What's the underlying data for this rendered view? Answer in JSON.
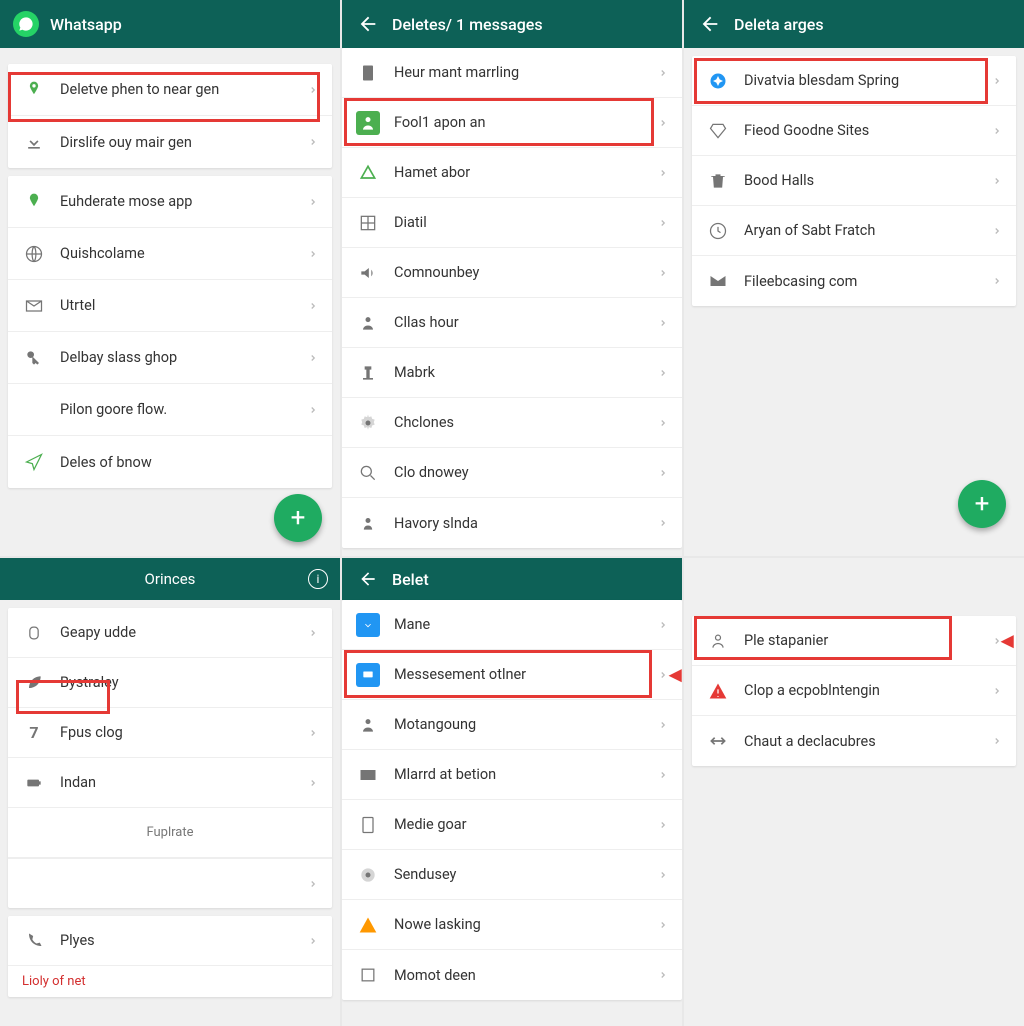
{
  "panel1": {
    "header_title": "Whatsapp",
    "top_items": [
      {
        "icon": "person-pin",
        "label": "Deletve phen to near gen",
        "green": true
      },
      {
        "icon": "download",
        "label": "Dirslife ouy mair gen",
        "green": false
      }
    ],
    "list_items": [
      {
        "icon": "person-pin",
        "label": "Euhderate mose app",
        "green": true
      },
      {
        "icon": "globe",
        "label": "Quishcolame",
        "green": false
      },
      {
        "icon": "mail",
        "label": "Utrtel",
        "green": false
      },
      {
        "icon": "key",
        "label": "Delbay slass ghop",
        "green": false
      },
      {
        "icon": "",
        "label": "Pilon goore flow.",
        "green": false
      },
      {
        "icon": "send",
        "label": "Deles of bnow",
        "green": true
      }
    ]
  },
  "panel2": {
    "header_title": "Deletes/ 1 messages",
    "items": [
      {
        "icon": "doc",
        "label": "Heur mant marrling"
      },
      {
        "icon": "person-green",
        "label": "Fool1 apon an",
        "green": true
      },
      {
        "icon": "triangle",
        "label": "Hamet abor",
        "green": true
      },
      {
        "icon": "grid",
        "label": "Diatil"
      },
      {
        "icon": "sound",
        "label": "Comnounbey"
      },
      {
        "icon": "person",
        "label": "Cllas hour"
      },
      {
        "icon": "monument",
        "label": "Mabrk"
      },
      {
        "icon": "gear",
        "label": "Chclones"
      },
      {
        "icon": "search-person",
        "label": "Clo dnowey"
      },
      {
        "icon": "contact",
        "label": "Havory slnda"
      }
    ]
  },
  "panel3": {
    "header_title": "Deleta arges",
    "items": [
      {
        "icon": "compass",
        "label": "Divatvia blesdam Spring",
        "blue": true
      },
      {
        "icon": "diamond",
        "label": "Fieod Goodne Sites"
      },
      {
        "icon": "trash",
        "label": "Bood Halls"
      },
      {
        "icon": "clock",
        "label": "Aryan of Sabt Fratch"
      },
      {
        "icon": "mail",
        "label": "Fileebcasing com"
      }
    ]
  },
  "panel4": {
    "header_title": "Orinces",
    "items": [
      {
        "icon": "zero",
        "label": "Geapy udde"
      },
      {
        "icon": "leaf",
        "label": "Bystraley"
      },
      {
        "icon": "seven",
        "label": "Fpus clog"
      },
      {
        "icon": "battery",
        "label": "Indan"
      }
    ],
    "footer_label": "Fuplrate",
    "bottom_items": [
      {
        "icon": "phone",
        "label": "Plyes"
      },
      {
        "icon": "photo",
        "label": "Lioly of net"
      }
    ]
  },
  "panel5": {
    "header_title": "Belet",
    "items": [
      {
        "icon": "download-blue",
        "label": "Mane",
        "blue": true
      },
      {
        "icon": "message-blue",
        "label": "Messesement otlner",
        "blue": true
      },
      {
        "icon": "person",
        "label": "Motangoung"
      },
      {
        "icon": "mail-dark",
        "label": "Mlarrd at betion"
      },
      {
        "icon": "tablet",
        "label": "Medie goar"
      },
      {
        "icon": "gear",
        "label": "Sendusey"
      },
      {
        "icon": "alert",
        "label": "Nowe lasking"
      },
      {
        "icon": "square",
        "label": "Momot deen"
      }
    ]
  },
  "panel6": {
    "items": [
      {
        "icon": "person-outline",
        "label": "Ple stapanier"
      },
      {
        "icon": "alert-red",
        "label": "Clop a ecpoblntengin"
      },
      {
        "icon": "arrows",
        "label": "Chaut a declacubres"
      }
    ]
  }
}
